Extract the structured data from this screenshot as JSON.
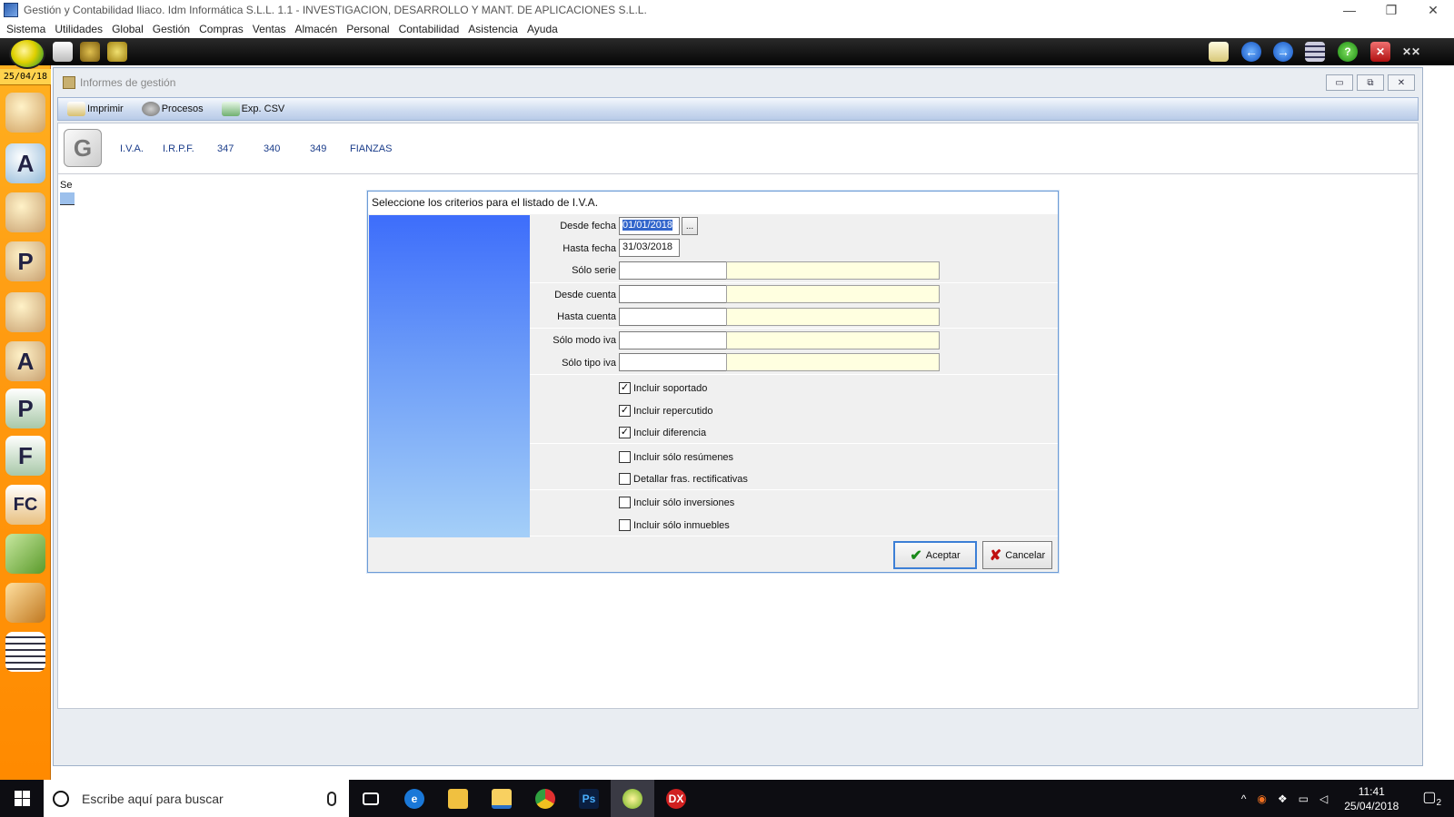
{
  "window": {
    "title": "Gestión y Contabilidad Iliaco. Idm Informática S.L.L. 1.1 - INVESTIGACION, DESARROLLO Y MANT. DE APLICACIONES S.L.L.",
    "minimize": "—",
    "restore": "❐",
    "close": "✕"
  },
  "menu": [
    "Sistema",
    "Utilidades",
    "Global",
    "Gestión",
    "Compras",
    "Ventas",
    "Almacén",
    "Personal",
    "Contabilidad",
    "Asistencia",
    "Ayuda"
  ],
  "sidebar": {
    "date": "25/04/18",
    "icons": [
      "users-icon",
      "letters-icon",
      "person-icon",
      "person-p-icon",
      "people-icon",
      "person-a-icon",
      "p-doc-icon",
      "f-doc-icon",
      "fc-doc-icon",
      "bag-green-icon",
      "bag-orange-icon",
      "list-doc-icon"
    ]
  },
  "mainwin": {
    "title": "Informes de gestión",
    "controls": [
      "▭",
      "⧉",
      "✕"
    ],
    "toolbar": {
      "print": "Imprimir",
      "processes": "Procesos",
      "export_csv": "Exp. CSV"
    },
    "tabs": [
      "I.V.A.",
      "I.R.P.F.",
      "347",
      "340",
      "349",
      "FIANZAS"
    ],
    "se_label": "Se"
  },
  "dialog": {
    "title": "Seleccione los criterios para el listado de I.V.A.",
    "fields": {
      "desde_fecha": {
        "label": "Desde fecha",
        "value": "01/01/2018",
        "picker": "..."
      },
      "hasta_fecha": {
        "label": "Hasta fecha",
        "value": "31/03/2018"
      },
      "solo_serie": {
        "label": "Sólo serie",
        "value": ""
      },
      "desde_cuenta": {
        "label": "Desde cuenta",
        "value": ""
      },
      "hasta_cuenta": {
        "label": "Hasta cuenta",
        "value": ""
      },
      "solo_modo_iva": {
        "label": "Sólo modo iva",
        "value": ""
      },
      "solo_tipo_iva": {
        "label": "Sólo tipo iva",
        "value": ""
      }
    },
    "checkboxes": [
      {
        "label": "Incluir soportado",
        "checked": true
      },
      {
        "label": "Incluir repercutido",
        "checked": true
      },
      {
        "label": "Incluir diferencia",
        "checked": true
      },
      {
        "label": "Incluir sólo resúmenes",
        "checked": false
      },
      {
        "label": "Detallar fras. rectificativas",
        "checked": false
      },
      {
        "label": "Incluir sólo inversiones",
        "checked": false
      },
      {
        "label": "Incluir sólo inmuebles",
        "checked": false
      }
    ],
    "accept": "Aceptar",
    "cancel": "Cancelar"
  },
  "taskbar": {
    "search_placeholder": "Escribe aquí para buscar",
    "apps": [
      "task-view-icon",
      "edge-icon",
      "folder-app-icon",
      "explorer-icon",
      "chrome-icon",
      "photoshop-icon",
      "gestion-app-icon",
      "dx-icon"
    ],
    "ps_label": "Ps",
    "dx_label": "DX",
    "time": "11:41",
    "date": "25/04/2018",
    "notifications": "2"
  }
}
